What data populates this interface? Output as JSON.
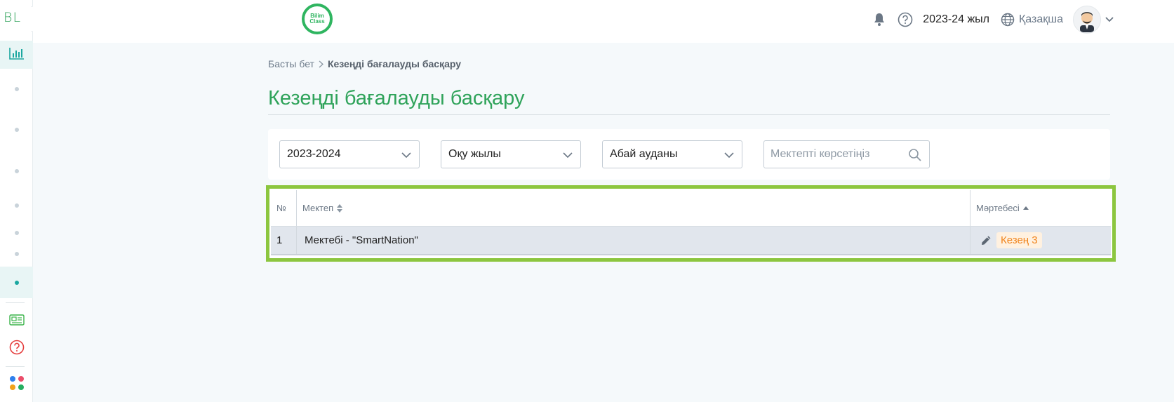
{
  "rail": {
    "logo": "BL",
    "items": [
      {
        "name": "analytics"
      },
      {
        "name": "nav-1"
      },
      {
        "name": "nav-2"
      },
      {
        "name": "nav-3"
      },
      {
        "name": "nav-4"
      },
      {
        "name": "nav-5"
      },
      {
        "name": "nav-6"
      },
      {
        "name": "nav-7-active"
      }
    ]
  },
  "header": {
    "brand_line1": "Bilim",
    "brand_line2": "Class",
    "year": "2023-24 жыл",
    "language": "Қазақша",
    "icons": [
      "bell-icon",
      "help-icon",
      "globe-icon",
      "chevron-down-icon"
    ]
  },
  "breadcrumb": {
    "home": "Басты бет",
    "current": "Кезеңді бағалауды басқару"
  },
  "page": {
    "title": "Кезеңді бағалауды басқару"
  },
  "filters": {
    "year_select": "2023-2024",
    "period_select": "Оқу жылы",
    "district_select": "Абай ауданы",
    "search_placeholder": "Мектепті көрсетіңіз"
  },
  "table": {
    "headers": {
      "num": "№",
      "school": "Мектеп",
      "status": "Мәртебесі"
    },
    "rows": [
      {
        "num": "1",
        "school": "Мектебі - \"SmartNation\"",
        "status": "Кезең 3"
      }
    ]
  },
  "colors": {
    "brand_green": "#2fa35a",
    "highlight_frame": "#8cc63f",
    "badge_text": "#f0851e",
    "badge_bg": "#fff1e0",
    "teal_accent": "#1aa7a0"
  }
}
